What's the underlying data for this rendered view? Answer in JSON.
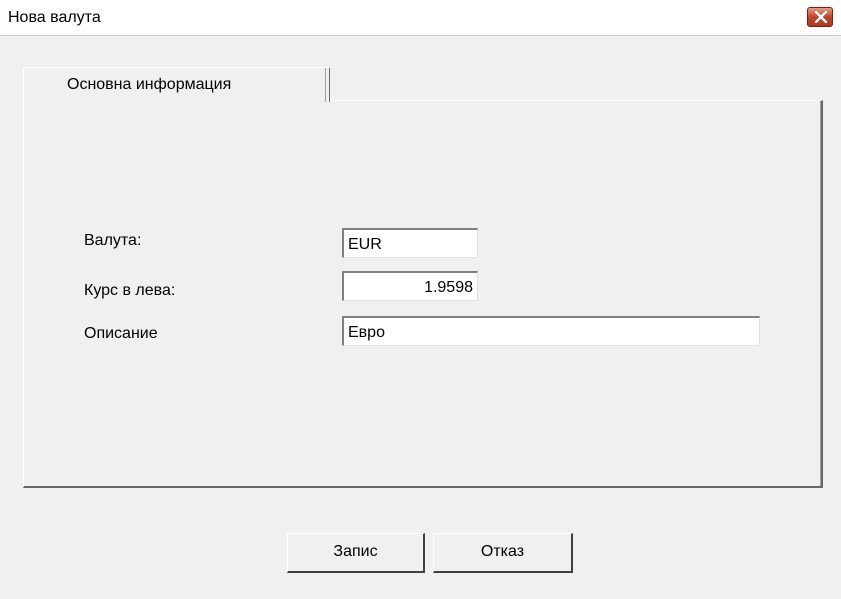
{
  "window": {
    "title": "Нова валута",
    "close_icon": "close-icon"
  },
  "tabs": [
    {
      "label": "Основна информация",
      "selected": true
    }
  ],
  "form": {
    "currency_label": "Валута:",
    "currency_value": "EUR",
    "rate_label": "Курс в лева:",
    "rate_value": "1.9598",
    "description_label": "Описание",
    "description_value": "Евро"
  },
  "buttons": {
    "save_label": "Запис",
    "cancel_label": "Отказ"
  },
  "colors": {
    "close_button": "#c4422a",
    "dialog_background": "#f0f0f0"
  }
}
